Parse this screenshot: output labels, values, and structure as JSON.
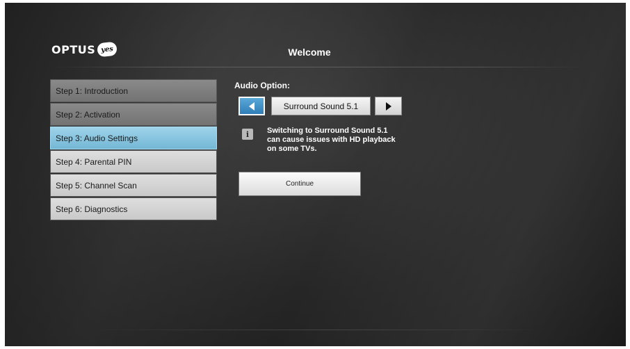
{
  "header": {
    "logo_text": "OPTUS",
    "logo_badge": "yes",
    "title": "Welcome"
  },
  "steps": [
    {
      "label": "Step 1: Introduction",
      "state": "done"
    },
    {
      "label": "Step 2: Activation",
      "state": "done"
    },
    {
      "label": "Step 3: Audio Settings",
      "state": "active"
    },
    {
      "label": "Step 4: Parental PIN",
      "state": "todo"
    },
    {
      "label": "Step 5: Channel Scan",
      "state": "todo"
    },
    {
      "label": "Step 6: Diagnostics",
      "state": "todo"
    }
  ],
  "audio": {
    "label": "Audio Option:",
    "value": "Surround Sound 5.1",
    "info_icon": "info-icon",
    "info_line1": "Switching to Surround Sound 5.1",
    "info_line2": "can cause issues with HD playback",
    "info_line3": "on some TVs."
  },
  "actions": {
    "continue_label": "Continue"
  },
  "colors": {
    "active_step": "#73b7d5",
    "selector_arrow": "#2f7db8",
    "background": "#262626"
  }
}
